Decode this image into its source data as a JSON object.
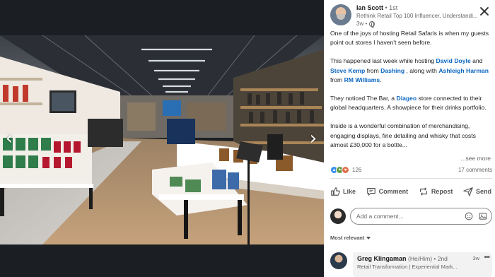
{
  "viewer": {
    "prev_glyph": "‹",
    "next_glyph": "›"
  },
  "author": {
    "name": "Ian Scott",
    "degree": "• 1st",
    "headline": "Rethink Retail Top 100 Influencer, Understandi...",
    "time": "3w •"
  },
  "post": {
    "p1": "One of the joys of hosting Retail Safaris is when my guests point out stores I haven't seen before.",
    "p2": {
      "t1": "This happened last week while hosting ",
      "m1": "David Doyle",
      "t2": " and ",
      "m2": "Steve Kemp",
      "t3": " from ",
      "m3": "Dashing",
      "t4": " , along with ",
      "m4": "Ashleigh Harman",
      "t5": " from ",
      "m5": "RM Williams",
      "t6": "."
    },
    "p3": {
      "t1": "They noticed The Bar, a ",
      "m1": "Diageo",
      "t2": " store connected to their global headquarters. A showpiece for their drinks portfolio."
    },
    "p4": "Inside is a wonderful combination of merchandising, engaging displays, fine detailing and whisky that costs almost £30,000 for a bottle...",
    "see_more": "...see more"
  },
  "social": {
    "reaction_count": "126",
    "comment_count": "17 comments"
  },
  "actions": {
    "like": "Like",
    "comment": "Comment",
    "repost": "Repost",
    "send": "Send"
  },
  "comment_box": {
    "placeholder": "Add a comment..."
  },
  "sort": {
    "label": "Most relevant"
  },
  "comment": {
    "name": "Greg Klingaman",
    "meta": "(He/Him) • 2nd",
    "headline": "Retail Transformation | Experiential Mark...",
    "time": "3w",
    "more": "•••"
  },
  "colors": {
    "accent": "#0a66c2",
    "viewer_bg": "#1b1f23"
  },
  "icons": [
    "chevron-left-icon",
    "chevron-right-icon",
    "close-icon",
    "globe-icon",
    "like-icon",
    "comment-icon",
    "repost-icon",
    "send-icon",
    "emoji-icon",
    "image-icon",
    "caret-down-icon",
    "more-icon"
  ]
}
